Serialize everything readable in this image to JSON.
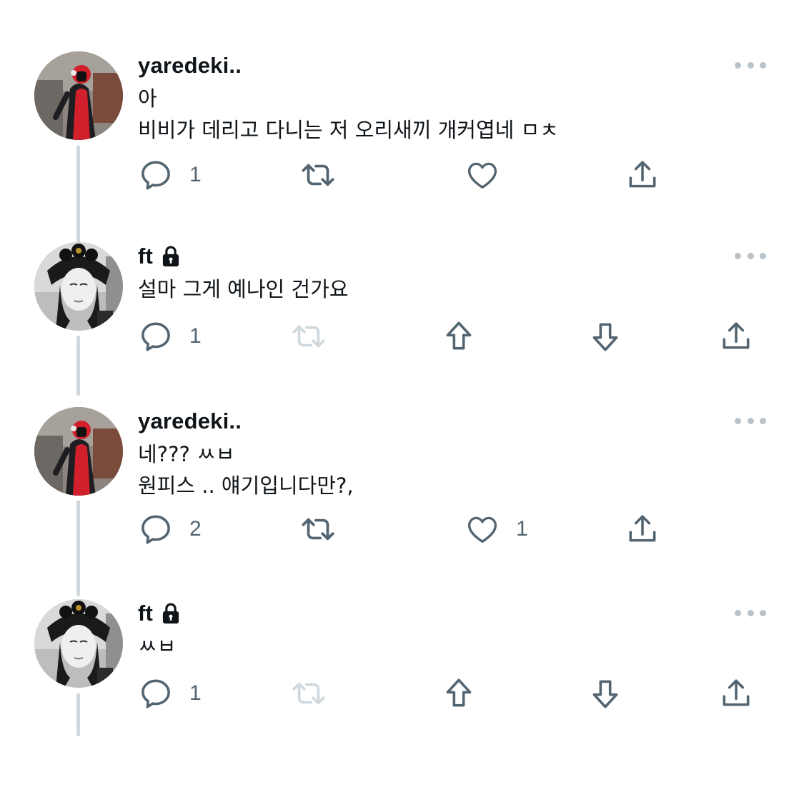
{
  "thread": [
    {
      "avatar": "red-hooded-person-avatar",
      "username": "yaredeki..",
      "locked": false,
      "lines": [
        "아",
        "비비가 데리고 다니는 저 오리새끼 개커엽네 ㅁㅊ"
      ],
      "actions": [
        {
          "icon": "reply-icon",
          "count": "1"
        },
        {
          "icon": "retweet-icon",
          "count": ""
        },
        {
          "icon": "like-icon",
          "count": ""
        },
        {
          "icon": "share-icon",
          "count": ""
        }
      ]
    },
    {
      "avatar": "woman-bw-avatar",
      "username": "ft",
      "locked": true,
      "lines": [
        "설마 그게 예나인 건가요"
      ],
      "actions": [
        {
          "icon": "reply-icon",
          "count": "1"
        },
        {
          "icon": "retweet-icon-disabled",
          "count": ""
        },
        {
          "icon": "upvote-icon",
          "count": ""
        },
        {
          "icon": "downvote-icon",
          "count": ""
        },
        {
          "icon": "share-icon",
          "count": ""
        }
      ]
    },
    {
      "avatar": "red-hooded-person-avatar",
      "username": "yaredeki..",
      "locked": false,
      "lines": [
        "네??? ㅆㅂ",
        "원피스 .. 얘기입니다만?,"
      ],
      "actions": [
        {
          "icon": "reply-icon",
          "count": "2"
        },
        {
          "icon": "retweet-icon",
          "count": ""
        },
        {
          "icon": "like-icon",
          "count": "1"
        },
        {
          "icon": "share-icon",
          "count": ""
        }
      ]
    },
    {
      "avatar": "woman-bw-avatar",
      "username": "ft",
      "locked": true,
      "lines": [
        "ㅆㅂ"
      ],
      "actions": [
        {
          "icon": "reply-icon",
          "count": "1"
        },
        {
          "icon": "retweet-icon-disabled",
          "count": ""
        },
        {
          "icon": "upvote-icon",
          "count": ""
        },
        {
          "icon": "downvote-icon",
          "count": ""
        },
        {
          "icon": "share-icon",
          "count": ""
        }
      ]
    }
  ],
  "colors": {
    "text": "#0f1419",
    "icon": "#536471",
    "icon_disabled": "#cfd9de",
    "thread_line": "#cfd9de",
    "more_dots": "#b9c2c8"
  }
}
